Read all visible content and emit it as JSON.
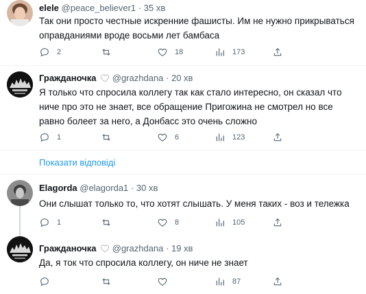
{
  "tweets": [
    {
      "name": "elele",
      "handle": "@peace_believer1",
      "sep": "·",
      "time": "35 хв",
      "text": "Так они просто честные искренние фашисты. Им не нужно прикрываться оправданиями вроде восьми лет бамбаса",
      "replies": "2",
      "retweets": "",
      "likes": "18",
      "views": "173"
    },
    {
      "name": "Гражданочка",
      "handle": "@grazhdana",
      "sep": "·",
      "time": "20 хв",
      "text": "Я только что спросила коллегу так как стало интересно, он сказал что ниче про это не знает, все обращение Пригожина не смотрел но все равно болеет за него, а Донбасс это очень сложно",
      "replies": "1",
      "retweets": "",
      "likes": "6",
      "views": "123"
    },
    {
      "name": "Elagorda",
      "handle": "@elagorda1",
      "sep": "·",
      "time": "30 хв",
      "text": "Они слышат только то, что хотят слышать. У меня таких  - воз и тележка",
      "replies": "1",
      "retweets": "",
      "likes": "8",
      "views": "105"
    },
    {
      "name": "Гражданочка",
      "handle": "@grazhdana",
      "sep": "·",
      "time": "19 хв",
      "text": "Да, я ток что спросила коллегу, он ниче не знает",
      "replies": "",
      "retweets": "",
      "likes": "",
      "views": "87"
    }
  ],
  "show_replies_label": "Показати відповіді",
  "colors": {
    "link": "#1d9bf0",
    "secondary": "#536471",
    "divider": "#eff3f4"
  },
  "icons": [
    "reply-icon",
    "retweet-icon",
    "like-icon",
    "views-icon",
    "share-icon",
    "white-heart-icon"
  ]
}
